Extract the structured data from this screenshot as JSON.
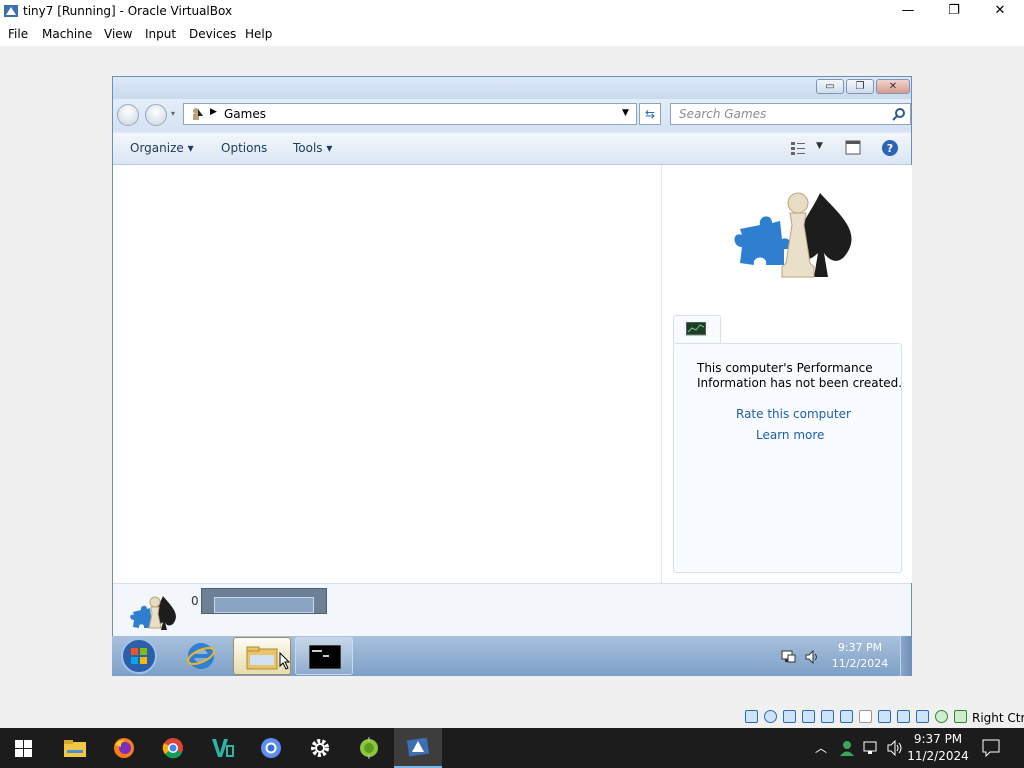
{
  "host_window": {
    "title": "tiny7 [Running] - Oracle VirtualBox",
    "controls": {
      "minimize": "—",
      "restore": "❐",
      "close": "✕"
    },
    "menu": [
      "File",
      "Machine",
      "View",
      "Input",
      "Devices",
      "Help"
    ],
    "status_host_key": "Right Ctrl"
  },
  "guest": {
    "explorer": {
      "breadcrumb": "Games",
      "search_placeholder": "Search Games",
      "toolbar": {
        "organize": "Organize",
        "options": "Options",
        "tools": "Tools"
      },
      "preview": {
        "perf_message_line1": "This computer's Performance",
        "perf_message_line2": "Information has not been created.",
        "rate_link": "Rate this computer",
        "learn_link": "Learn more"
      },
      "details": {
        "count": "0"
      }
    },
    "taskbar": {
      "time": "9:37 PM",
      "date": "11/2/2024"
    }
  },
  "host_taskbar": {
    "time": "9:37 PM",
    "date": "11/2/2024"
  },
  "colors": {
    "link": "#1e5fa8",
    "accent": "#1e395b"
  }
}
